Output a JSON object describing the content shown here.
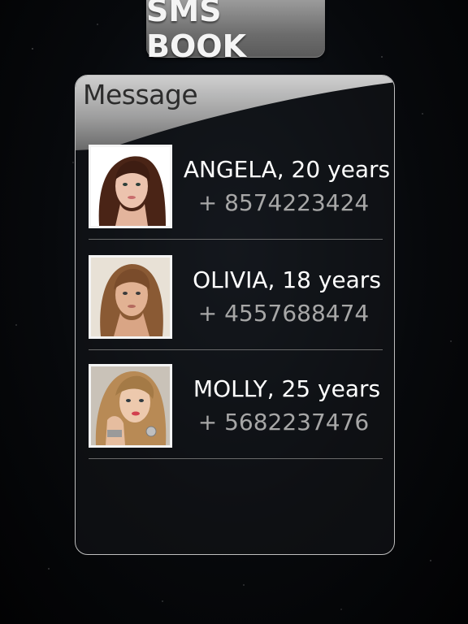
{
  "app": {
    "title": "SMS BOOK"
  },
  "panel": {
    "header": "Message"
  },
  "contacts": [
    {
      "name": "ANGELA, 20 years",
      "phone": "+ 8574223424"
    },
    {
      "name": "OLIVIA, 18 years",
      "phone": "+ 4557688474"
    },
    {
      "name": "MOLLY, 25 years",
      "phone": "+ 5682237476"
    }
  ],
  "colors": {
    "background": "#07090c",
    "title_tab": "#7a7a7a",
    "name_text": "#ffffff",
    "phone_text": "#a7a7a7",
    "panel_border": "#bfbfbf"
  }
}
